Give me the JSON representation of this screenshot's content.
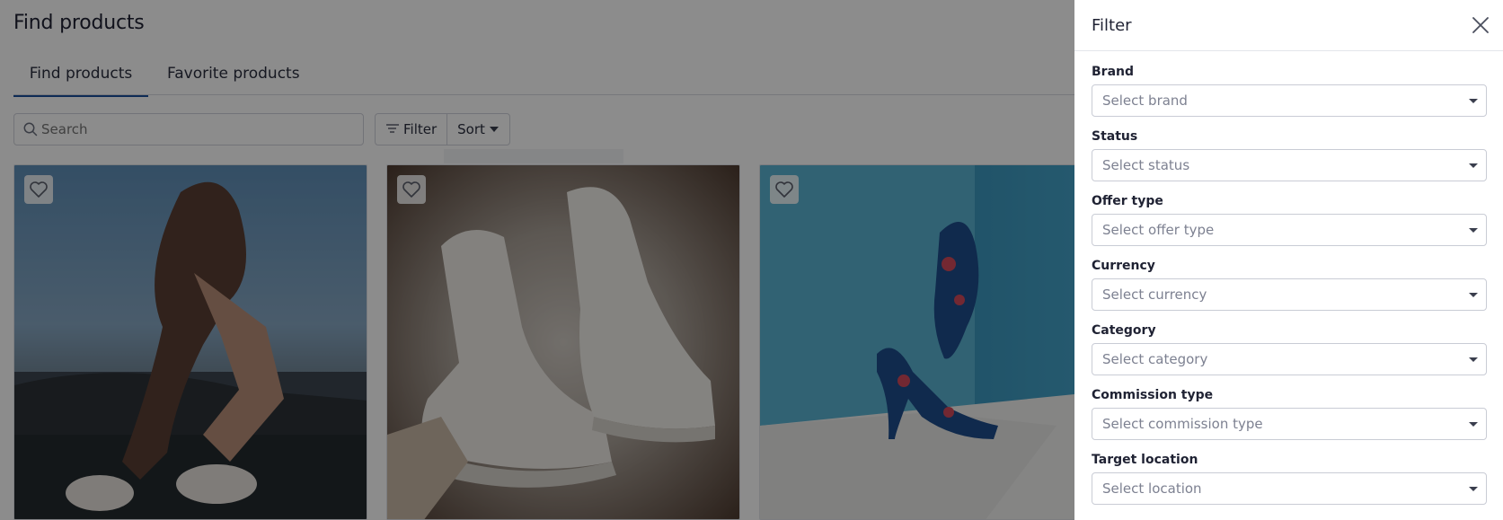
{
  "page": {
    "title": "Find products"
  },
  "tabs": [
    {
      "label": "Find products",
      "active": true
    },
    {
      "label": "Favorite products",
      "active": false
    }
  ],
  "toolbar": {
    "search_placeholder": "Search",
    "filter_label": "Filter",
    "sort_label": "Sort"
  },
  "products": [
    {
      "favorite": false,
      "image": "woman-with-sneakers-photo"
    },
    {
      "favorite": false,
      "image": "white-chelsea-boots-photo"
    },
    {
      "favorite": false,
      "image": "floral-high-heels-photo"
    }
  ],
  "filter_panel": {
    "title": "Filter",
    "fields": [
      {
        "label": "Brand",
        "placeholder": "Select brand"
      },
      {
        "label": "Status",
        "placeholder": "Select status"
      },
      {
        "label": "Offer type",
        "placeholder": "Select offer type"
      },
      {
        "label": "Currency",
        "placeholder": "Select currency"
      },
      {
        "label": "Category",
        "placeholder": "Select category"
      },
      {
        "label": "Commission type",
        "placeholder": "Select commission type"
      },
      {
        "label": "Target location",
        "placeholder": "Select location"
      }
    ]
  },
  "colors": {
    "accent": "#1a4f9c",
    "overlay": "rgba(0,0,0,0.45)"
  }
}
